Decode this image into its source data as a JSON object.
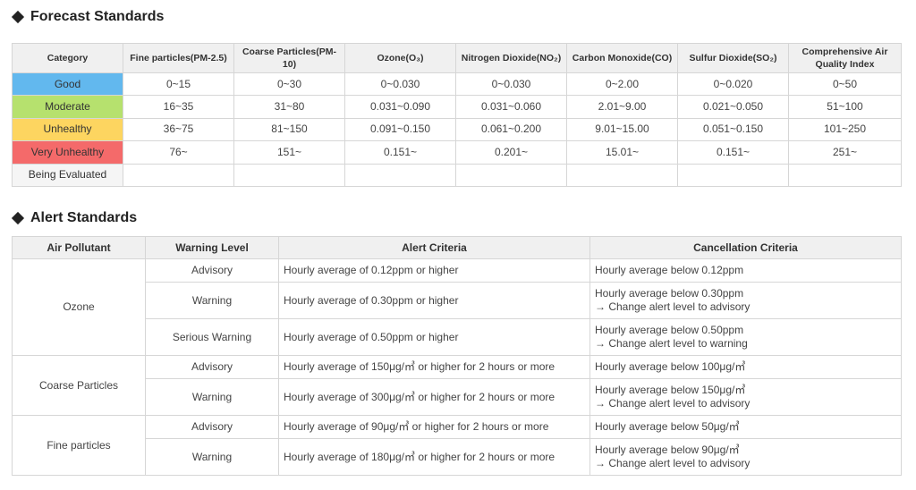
{
  "forecast": {
    "title": "Forecast Standards",
    "headers": [
      "Category",
      "Fine particles(PM-2.5)",
      "Coarse Particles(PM-10)",
      "Ozone(O₃)",
      "Nitrogen Dioxide(NO₂)",
      "Carbon Monoxide(CO)",
      "Sulfur Dioxide(SO₂)",
      "Comprehensive Air Quality Index"
    ],
    "rows": [
      {
        "category": "Good",
        "color": "#62b8ee",
        "values": [
          "0~15",
          "0~30",
          "0~0.030",
          "0~0.030",
          "0~2.00",
          "0~0.020",
          "0~50"
        ]
      },
      {
        "category": "Moderate",
        "color": "#b6e16e",
        "values": [
          "16~35",
          "31~80",
          "0.031~0.090",
          "0.031~0.060",
          "2.01~9.00",
          "0.021~0.050",
          "51~100"
        ]
      },
      {
        "category": "Unhealthy",
        "color": "#fdd560",
        "values": [
          "36~75",
          "81~150",
          "0.091~0.150",
          "0.061~0.200",
          "9.01~15.00",
          "0.051~0.150",
          "101~250"
        ]
      },
      {
        "category": "Very Unhealthy",
        "color": "#f46a6a",
        "values": [
          "76~",
          "151~",
          "0.151~",
          "0.201~",
          "15.01~",
          "0.151~",
          "251~"
        ]
      },
      {
        "category": "Being Evaluated",
        "color": "#f5f5f5",
        "values": [
          "",
          "",
          "",
          "",
          "",
          "",
          ""
        ]
      }
    ]
  },
  "alert": {
    "title": "Alert Standards",
    "headers": [
      "Air Pollutant",
      "Warning Level",
      "Alert Criteria",
      "Cancellation Criteria"
    ],
    "groups": [
      {
        "pollutant": "Ozone",
        "rows": [
          {
            "level": "Advisory",
            "criteria": "Hourly average of 0.12ppm or higher",
            "cancel": "Hourly average below 0.12ppm",
            "cancel_note": ""
          },
          {
            "level": "Warning",
            "criteria": "Hourly average of 0.30ppm or higher",
            "cancel": "Hourly average below 0.30ppm",
            "cancel_note": "→ Change alert level to advisory"
          },
          {
            "level": "Serious Warning",
            "criteria": "Hourly average of 0.50ppm or higher",
            "cancel": "Hourly average below 0.50ppm",
            "cancel_note": "→ Change alert level to warning"
          }
        ]
      },
      {
        "pollutant": "Coarse Particles",
        "rows": [
          {
            "level": "Advisory",
            "criteria": "Hourly average of 150μg/㎥ or higher for 2 hours or more",
            "cancel": "Hourly average below 100μg/㎥",
            "cancel_note": ""
          },
          {
            "level": "Warning",
            "criteria": "Hourly average of 300μg/㎥ or higher for 2 hours or more",
            "cancel": "Hourly average below 150μg/㎥",
            "cancel_note": "→ Change alert level to advisory"
          }
        ]
      },
      {
        "pollutant": "Fine particles",
        "rows": [
          {
            "level": "Advisory",
            "criteria": "Hourly average of 90μg/㎥ or higher for 2 hours or more",
            "cancel": "Hourly average below 50μg/㎥",
            "cancel_note": ""
          },
          {
            "level": "Warning",
            "criteria": "Hourly average of 180μg/㎥ or higher for 2 hours or more",
            "cancel": "Hourly average below 90μg/㎥",
            "cancel_note": "→ Change alert level to advisory"
          }
        ]
      }
    ]
  }
}
